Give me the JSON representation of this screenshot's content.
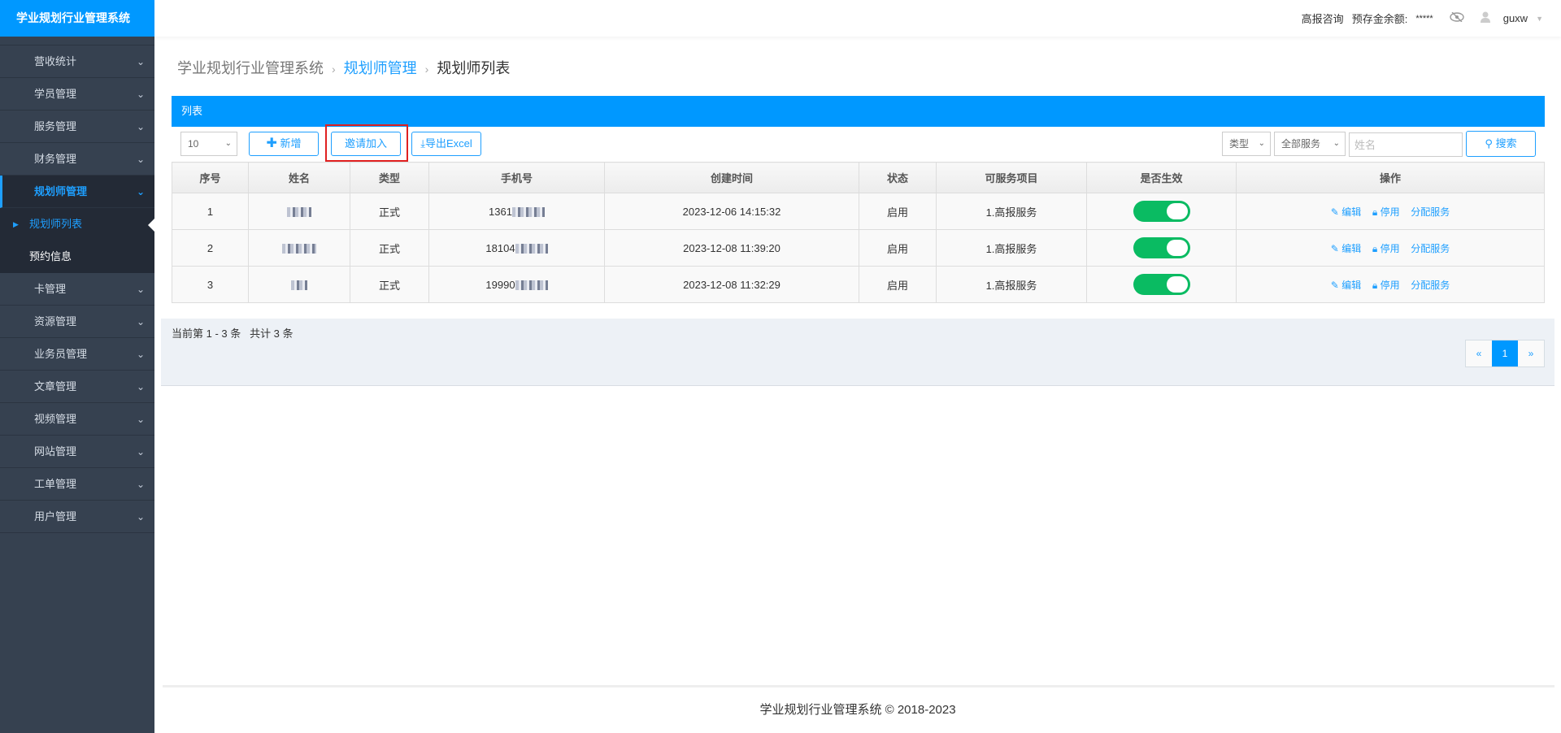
{
  "app_title": "学业规划行业管理系统",
  "sidebar": {
    "items": [
      {
        "label": "营收统计"
      },
      {
        "label": "学员管理"
      },
      {
        "label": "服务管理"
      },
      {
        "label": "财务管理"
      },
      {
        "label": "规划师管理",
        "active": true,
        "children": [
          {
            "label": "规划师列表",
            "current": true
          },
          {
            "label": "预约信息"
          }
        ]
      },
      {
        "label": "卡管理"
      },
      {
        "label": "资源管理"
      },
      {
        "label": "业务员管理"
      },
      {
        "label": "文章管理"
      },
      {
        "label": "视频管理"
      },
      {
        "label": "网站管理"
      },
      {
        "label": "工单管理"
      },
      {
        "label": "用户管理"
      }
    ]
  },
  "topbar": {
    "consult": "高报咨询",
    "balance_label": "预存金余额:",
    "balance_value": "*****",
    "username": "guxw"
  },
  "breadcrumb": {
    "root": "学业规划行业管理系统",
    "section": "规划师管理",
    "current": "规划师列表"
  },
  "panel": {
    "title": "列表"
  },
  "toolbar": {
    "page_size": "10",
    "add_label": "新增",
    "invite_label": "邀请加入",
    "export_label": "导出Excel",
    "type_select": "类型",
    "service_select": "全部服务",
    "name_placeholder": "姓名",
    "search_label": "搜索"
  },
  "table": {
    "headers": [
      "序号",
      "姓名",
      "类型",
      "手机号",
      "创建时间",
      "状态",
      "可服务项目",
      "是否生效",
      "操作"
    ],
    "rows": [
      {
        "no": "1",
        "type": "正式",
        "phone": "1361",
        "created": "2023-12-06 14:15:32",
        "status": "启用",
        "service": "1.高报服务",
        "enabled": true
      },
      {
        "no": "2",
        "type": "正式",
        "phone": "18104",
        "created": "2023-12-08 11:39:20",
        "status": "启用",
        "service": "1.高报服务",
        "enabled": true
      },
      {
        "no": "3",
        "type": "正式",
        "phone": "19990",
        "created": "2023-12-08 11:32:29",
        "status": "启用",
        "service": "1.高报服务",
        "enabled": true
      }
    ],
    "actions": {
      "edit": "编辑",
      "disable": "停用",
      "assign": "分配服务"
    }
  },
  "pagination": {
    "info": "当前第 1 - 3 条   共计 3 条",
    "prev": "«",
    "current": "1",
    "next": "»"
  },
  "footer": "学业规划行业管理系统 © 2018-2023"
}
